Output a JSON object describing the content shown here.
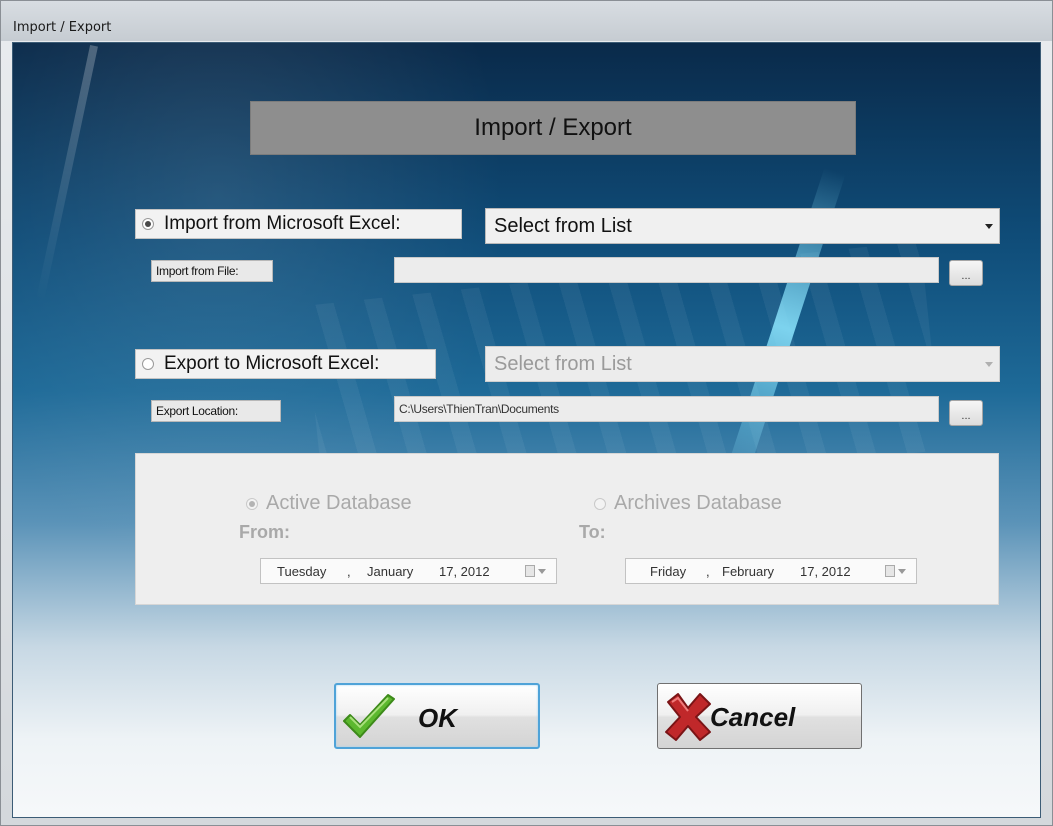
{
  "window": {
    "title": "Import / Export"
  },
  "header": {
    "title": "Import / Export"
  },
  "import": {
    "option_label": "Import from Microsoft Excel:",
    "selected": true,
    "list_value": "Select from List",
    "file_label": "Import from File:",
    "file_value": "",
    "browse_label": "..."
  },
  "export": {
    "option_label": "Export to Microsoft Excel:",
    "selected": false,
    "list_value": "Select from List",
    "location_label": "Export Location:",
    "location_value": "C:\\Users\\ThienTran\\Documents",
    "browse_label": "..."
  },
  "database": {
    "active_label": "Active Database",
    "archives_label": "Archives Database",
    "active_selected": true,
    "from_label": "From:",
    "to_label": "To:",
    "from_date": {
      "weekday": "Tuesday",
      "sep": ",",
      "month": "January",
      "day_year": "17, 2012"
    },
    "to_date": {
      "weekday": "Friday",
      "sep": ",",
      "month": "February",
      "day_year": "17, 2012"
    }
  },
  "buttons": {
    "ok_label": "OK",
    "cancel_label": "Cancel"
  },
  "colors": {
    "ok_icon": "#5cb82e",
    "cancel_icon": "#c0282a",
    "ok_border": "#4fa3d8"
  },
  "icons": {
    "ok": "checkmark-icon",
    "cancel": "x-cross-icon",
    "calendar": "calendar-icon"
  }
}
